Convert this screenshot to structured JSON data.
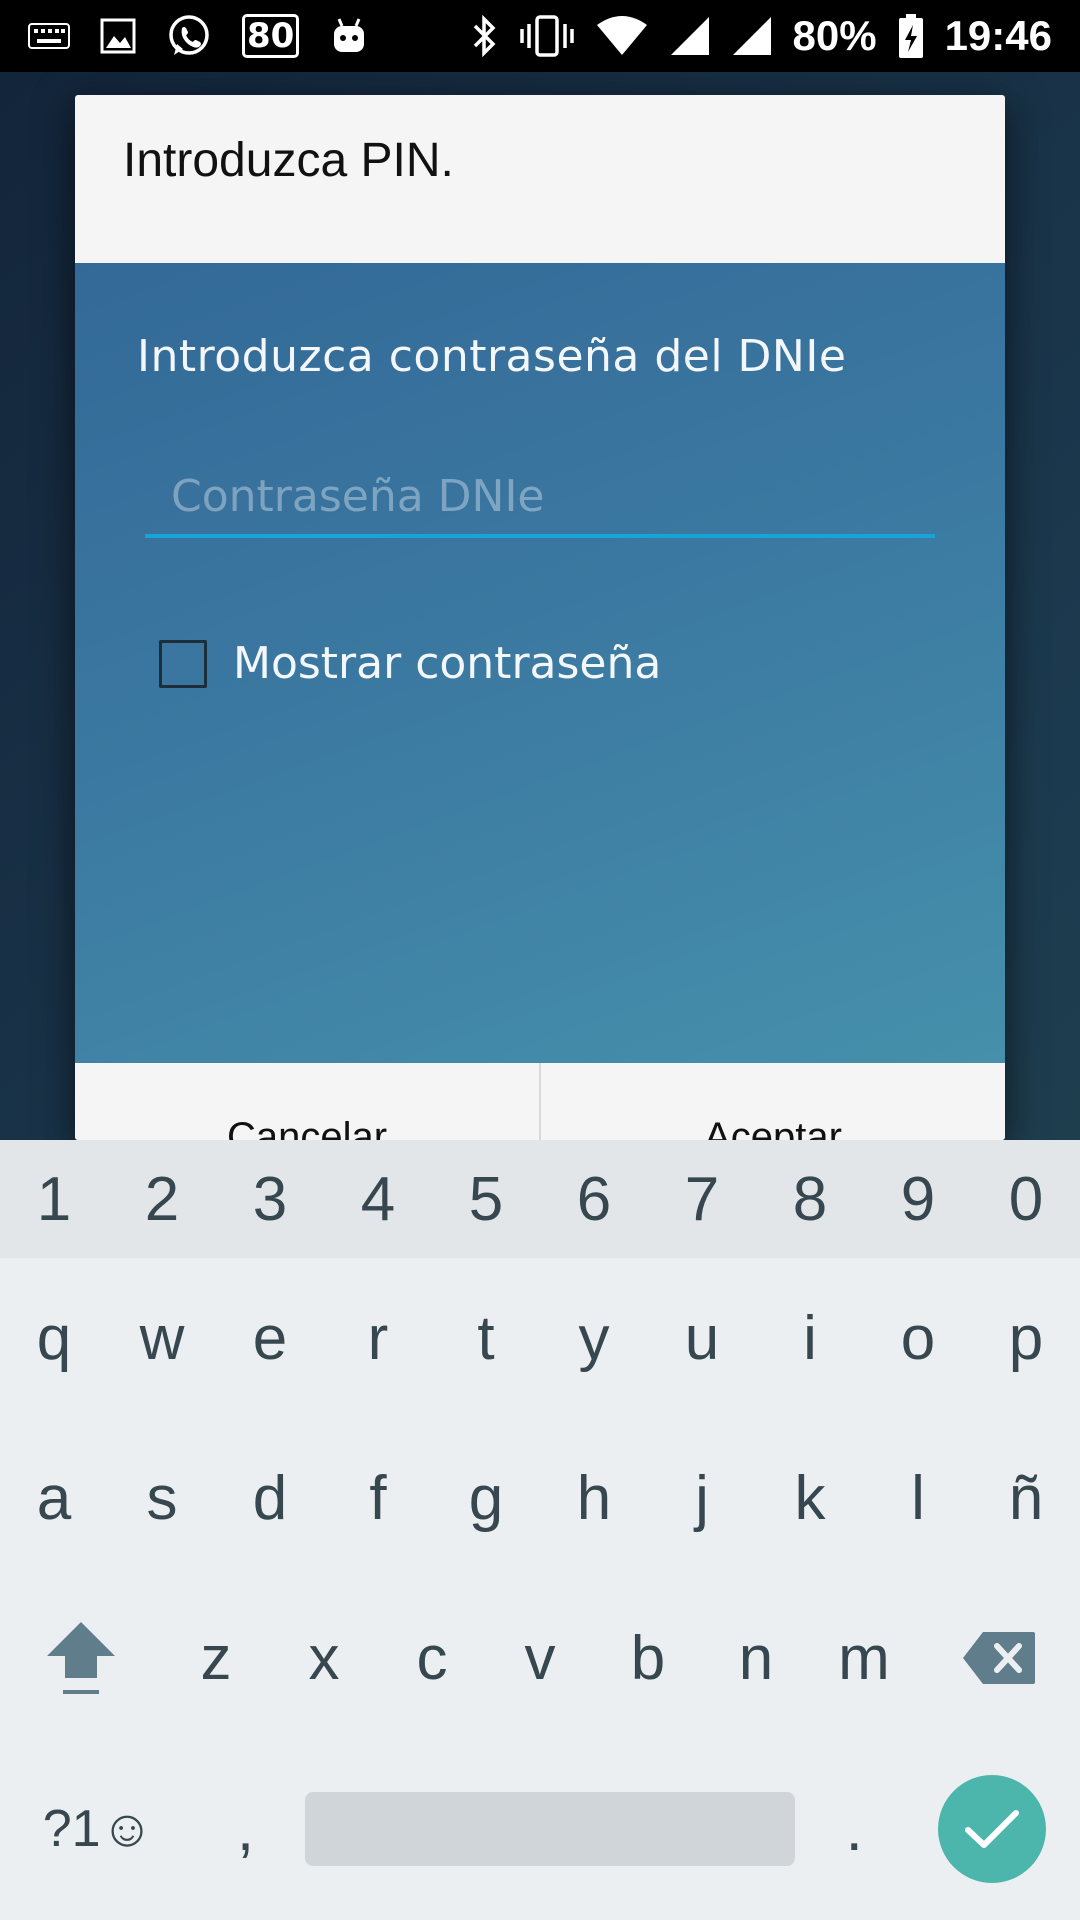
{
  "status_bar": {
    "notification_badge": "80",
    "battery_percent": "80%",
    "time": "19:46",
    "icons_left": [
      "keyboard-icon",
      "image-icon",
      "whatsapp-icon",
      "badge-80-icon",
      "android-icon"
    ],
    "icons_right": [
      "bluetooth-icon",
      "vibrate-icon",
      "wifi-icon",
      "signal-icon",
      "signal-icon",
      "battery-charging-icon"
    ]
  },
  "dialog": {
    "title": "Introduzca PIN.",
    "prompt": "Introduzca contraseña del DNIe",
    "password_placeholder": "Contraseña DNIe",
    "password_value": "",
    "show_password_label": "Mostrar contraseña",
    "show_password_checked": false,
    "cancel_label": "Cancelar",
    "accept_label": "Aceptar",
    "accent_color": "#1aa3d9"
  },
  "keyboard": {
    "number_row": [
      "1",
      "2",
      "3",
      "4",
      "5",
      "6",
      "7",
      "8",
      "9",
      "0"
    ],
    "row1": [
      "q",
      "w",
      "e",
      "r",
      "t",
      "y",
      "u",
      "i",
      "o",
      "p"
    ],
    "row2": [
      "a",
      "s",
      "d",
      "f",
      "g",
      "h",
      "j",
      "k",
      "l",
      "ñ"
    ],
    "row3": [
      "z",
      "x",
      "c",
      "v",
      "b",
      "n",
      "m"
    ],
    "symbols_label": "?1☺",
    "comma": ",",
    "period": ".",
    "enter_color": "#4db6ac"
  }
}
